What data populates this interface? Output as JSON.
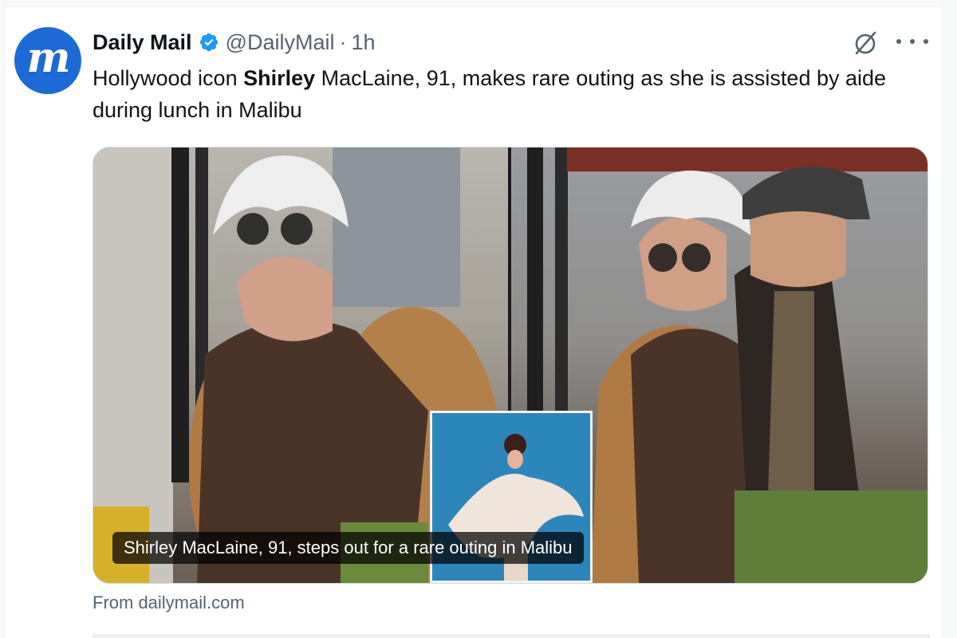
{
  "post": {
    "author_name": "Daily Mail",
    "avatar_glyph": "m",
    "handle": "@DailyMail",
    "separator": "·",
    "timestamp": "1h",
    "text_before": "Hollywood icon ",
    "text_bold": "Shirley",
    "text_after": " MacLaine, 91, makes rare outing as she is assisted by aide during lunch in Malibu"
  },
  "card": {
    "caption": "Shirley MacLaine, 91, steps out for a rare outing in Malibu",
    "source": "From dailymail.com"
  },
  "colors": {
    "avatar_bg": "#1d69d6",
    "verified": "#1d9bf0",
    "text_primary": "#0f1419",
    "text_secondary": "#536471"
  },
  "icons": [
    "verified-badge-icon",
    "grok-icon",
    "more-options-icon"
  ]
}
